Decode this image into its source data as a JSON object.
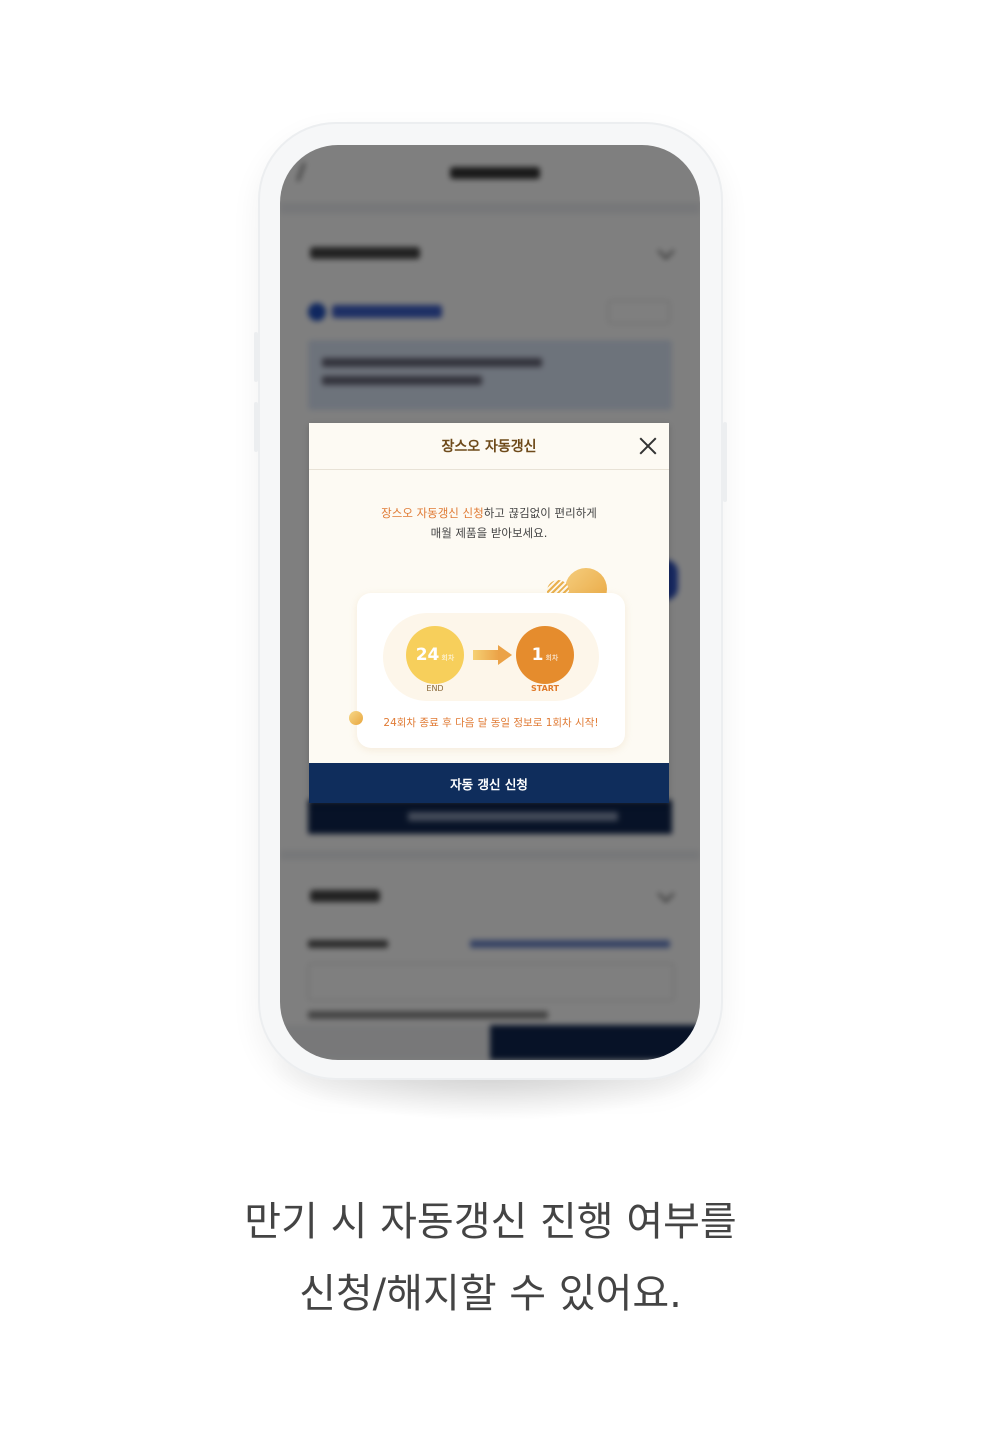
{
  "modal": {
    "title": "장스오 자동갱신",
    "description": {
      "highlight": "장스오 자동갱신 신청",
      "line1_rest": "하고 끊김없이 편리하게",
      "line2": "매월 제품을 받아보세요."
    },
    "diagram": {
      "from_number": "24",
      "from_unit": "회차",
      "from_label": "END",
      "to_number": "1",
      "to_unit": "회차",
      "to_label": "START",
      "note": "24회차 종료 후 다음 달 동일 정보로 1회차 시작!"
    },
    "confirm_button": "자동 갱신 신청"
  },
  "caption": {
    "line1": "만기 시 자동갱신 진행 여부를",
    "line2": "신청/해지할 수 있어요."
  },
  "colors": {
    "navy": "#0f2d5c",
    "accent_orange": "#e07b35",
    "title_brown": "#6e4a1a",
    "modal_bg": "#fdfaf3"
  }
}
